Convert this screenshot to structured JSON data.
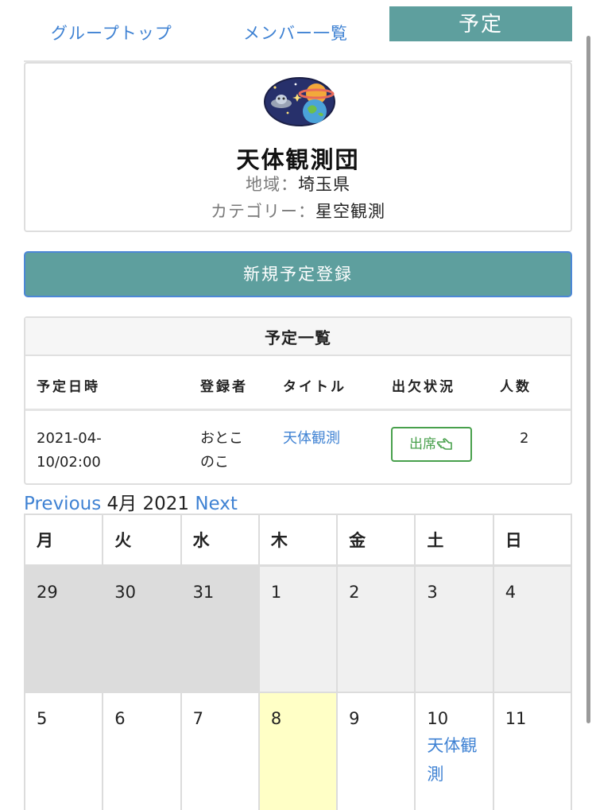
{
  "tabs": [
    {
      "label": "グループトップ"
    },
    {
      "label": "メンバー一覧"
    },
    {
      "label": "予定"
    }
  ],
  "group": {
    "name": "天体観測団",
    "region_label": "地域：",
    "region_value": "埼玉県",
    "category_label": "カテゴリー：",
    "category_value": "星空観測",
    "logo_icon": "space-planet-ufo-icon"
  },
  "new_schedule_button": "新規予定登録",
  "schedule_list": {
    "title": "予定一覧",
    "headers": [
      "予定日時",
      "登録者",
      "タイトル",
      "出欠状況",
      "人数"
    ],
    "rows": [
      {
        "datetime": "2021-04-10/02:00",
        "registrant": "おとこのこ",
        "title": "天体観測",
        "attendance": "出席",
        "attendance_icon": "pointing-hand-icon",
        "count": "2"
      }
    ]
  },
  "calendar": {
    "prev_label": "Previous",
    "month_label": "4月 2021",
    "next_label": "Next",
    "weekdays": [
      "月",
      "火",
      "水",
      "木",
      "金",
      "土",
      "日"
    ],
    "weeks": [
      [
        {
          "day": "29"
        },
        {
          "day": "30"
        },
        {
          "day": "31"
        },
        {
          "day": "1"
        },
        {
          "day": "2"
        },
        {
          "day": "3"
        },
        {
          "day": "4"
        }
      ],
      [
        {
          "day": "5"
        },
        {
          "day": "6"
        },
        {
          "day": "7"
        },
        {
          "day": "8"
        },
        {
          "day": "9"
        },
        {
          "day": "10",
          "event": "天体観測"
        },
        {
          "day": "11"
        }
      ]
    ]
  },
  "colors": {
    "accent_teal": "#5e9f9e",
    "link_blue": "#3f82d3",
    "attend_green": "#48a04c",
    "today_yellow": "#ffffc6"
  }
}
